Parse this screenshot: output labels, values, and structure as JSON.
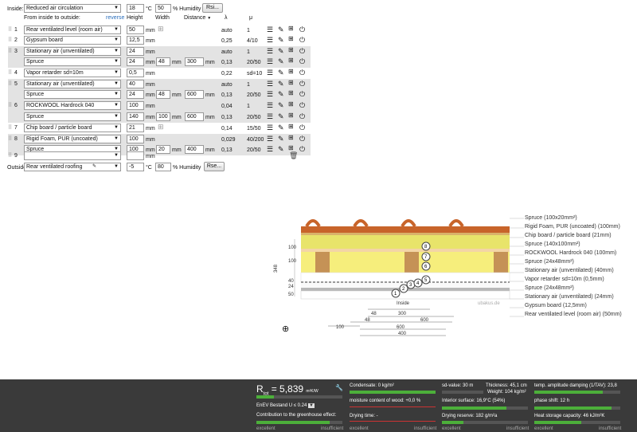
{
  "inside": {
    "label": "Inside:",
    "select": "Reduced air circulation",
    "temp": "18",
    "temp_unit": "°C",
    "hum": "50",
    "hum_label": "% Humidity",
    "btn": "Rsi..."
  },
  "header": {
    "from": "From inside to outside:",
    "reverse": "reverse",
    "height": "Height",
    "width": "Width",
    "distance": "Distance",
    "lambda": "λ",
    "mu": "μ"
  },
  "units": {
    "mm": "mm"
  },
  "layers": [
    {
      "num": "1",
      "name": "Rear ventilated level (room air)",
      "h": "50",
      "lambda": "auto",
      "mu": "1"
    },
    {
      "num": "2",
      "name": "Gypsum board",
      "h": "12,5",
      "lambda": "0,25",
      "mu": "4/10"
    },
    {
      "num": "3",
      "name": "Stationary air (unventilated)",
      "h": "24",
      "lambda": "auto",
      "mu": "1",
      "sub": {
        "name": "Spruce",
        "h": "24",
        "w": "48",
        "d": "300",
        "lambda": "0,13",
        "mu": "20/50"
      }
    },
    {
      "num": "4",
      "name": "Vapor retarder sd=10m",
      "h": "0,5",
      "lambda": "0,22",
      "mu": "sd=10"
    },
    {
      "num": "5",
      "name": "Stationary air (unventilated)",
      "h": "40",
      "lambda": "auto",
      "mu": "1",
      "sub": {
        "name": "Spruce",
        "h": "24",
        "w": "48",
        "d": "600",
        "lambda": "0,13",
        "mu": "20/50"
      }
    },
    {
      "num": "6",
      "name": "ROCKWOOL Hardrock 040",
      "h": "100",
      "lambda": "0,04",
      "mu": "1",
      "sub": {
        "name": "Spruce",
        "h": "140",
        "w": "100",
        "d": "600",
        "lambda": "0,13",
        "mu": "20/50"
      }
    },
    {
      "num": "7",
      "name": "Chip board / particle board",
      "h": "21",
      "lambda": "0,14",
      "mu": "15/50"
    },
    {
      "num": "8",
      "name": "Rigid Foam, PUR (uncoated)",
      "h": "100",
      "lambda": "0,029",
      "mu": "40/200",
      "sub": {
        "name": "Spruce",
        "h": "100",
        "w": "20",
        "d": "400",
        "lambda": "0,13",
        "mu": "20/50"
      }
    }
  ],
  "row9": {
    "num": "9",
    "h": ""
  },
  "outside": {
    "label": "Outside",
    "select": "Rear ventilated roofing",
    "temp": "-5",
    "temp_unit": "°C",
    "hum": "80",
    "hum_label": "% Humidity",
    "btn": "Rse..."
  },
  "diagram": {
    "labels": [
      "Spruce (100x20mm²)",
      "Rigid Foam, PUR (uncoated) (100mm)",
      "Chip board / particle board (21mm)",
      "Spruce (140x100mm²)",
      "ROCKWOOL Hardrock 040 (100mm)",
      "Spruce (24x48mm²)",
      "Stationary air (unventilated) (40mm)",
      "Vapor retarder sd=10m (0,5mm)",
      "Spruce (24x48mm²)",
      "Stationary air (unventilated) (24mm)",
      "Gypsum board (12,5mm)",
      "Rear ventilated level (room air) (50mm)"
    ],
    "left_dims": [
      "100",
      "348",
      "100",
      "40",
      "24",
      "50"
    ],
    "inside_text": "Inside",
    "watermark": "ubakus.de",
    "bottom_dims": [
      "48",
      "300",
      "48",
      "600",
      "100",
      "600",
      "400"
    ],
    "circles": [
      "1",
      "2",
      "3",
      "4",
      "5",
      "6",
      "7",
      "8"
    ]
  },
  "results": {
    "rtot_label": "R",
    "rtot_sub": "tot",
    "rtot_eq": "= 5,839",
    "rtot_unit": "m²K/W",
    "enev": "EnEV Bestand U ≤ 0.24",
    "greenhouse": "Contribution to the greenhouse effect:",
    "condensate": "Condensate: 0 kg/m²",
    "moisture": "moisture content of wood: +0,0 %",
    "drying_time": "Drying time: -",
    "sd": "sd-value: 30 m",
    "interior": "Interior surface: 16,9°C (54%)",
    "drying_reserve": "Drying reserve: 182 g/m²a",
    "thickness": "Thickness: 45,1 cm",
    "weight": "Weight: 104 kg/m²",
    "damping": "temp. amplitude damping (1/TAV): 23,8",
    "phase": "phase shift: 12 h",
    "heat": "Heat storage capacity: 46 kJ/m²K",
    "excellent": "excellent",
    "insufficient": "insufficient"
  }
}
